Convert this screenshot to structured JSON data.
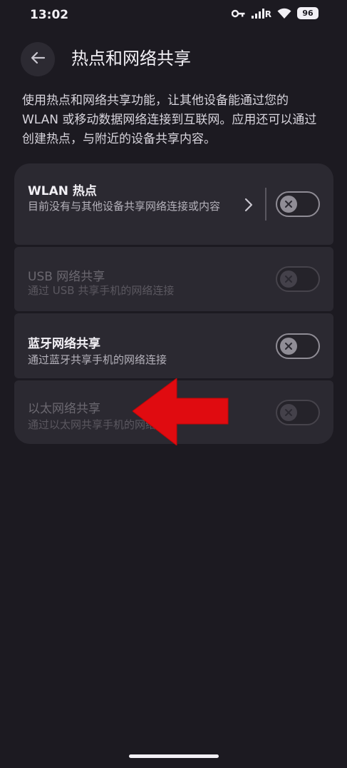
{
  "status_bar": {
    "time": "13:02",
    "network_label": "R",
    "battery": "96"
  },
  "header": {
    "title": "热点和网络共享"
  },
  "description": "使用热点和网络共享功能，让其他设备能通过您的 WLAN 或移动数据网络连接到互联网。应用还可以通过创建热点，与附近的设备共享内容。",
  "settings": [
    {
      "title": "WLAN 热点",
      "summary": "目前没有与其他设备共享网络连接或内容",
      "enabled": true,
      "checked": false
    },
    {
      "title": "USB 网络共享",
      "summary": "通过 USB 共享手机的网络连接",
      "enabled": false,
      "checked": false
    },
    {
      "title": "蓝牙网络共享",
      "summary": "通过蓝牙共享手机的网络连接",
      "enabled": true,
      "checked": false
    },
    {
      "title": "以太网络共享",
      "summary": "通过以太网共享手机的网络连接",
      "enabled": false,
      "checked": false
    }
  ],
  "colors": {
    "background": "#1c1a21",
    "card": "#2b2931",
    "arrow": "#e00b10"
  }
}
